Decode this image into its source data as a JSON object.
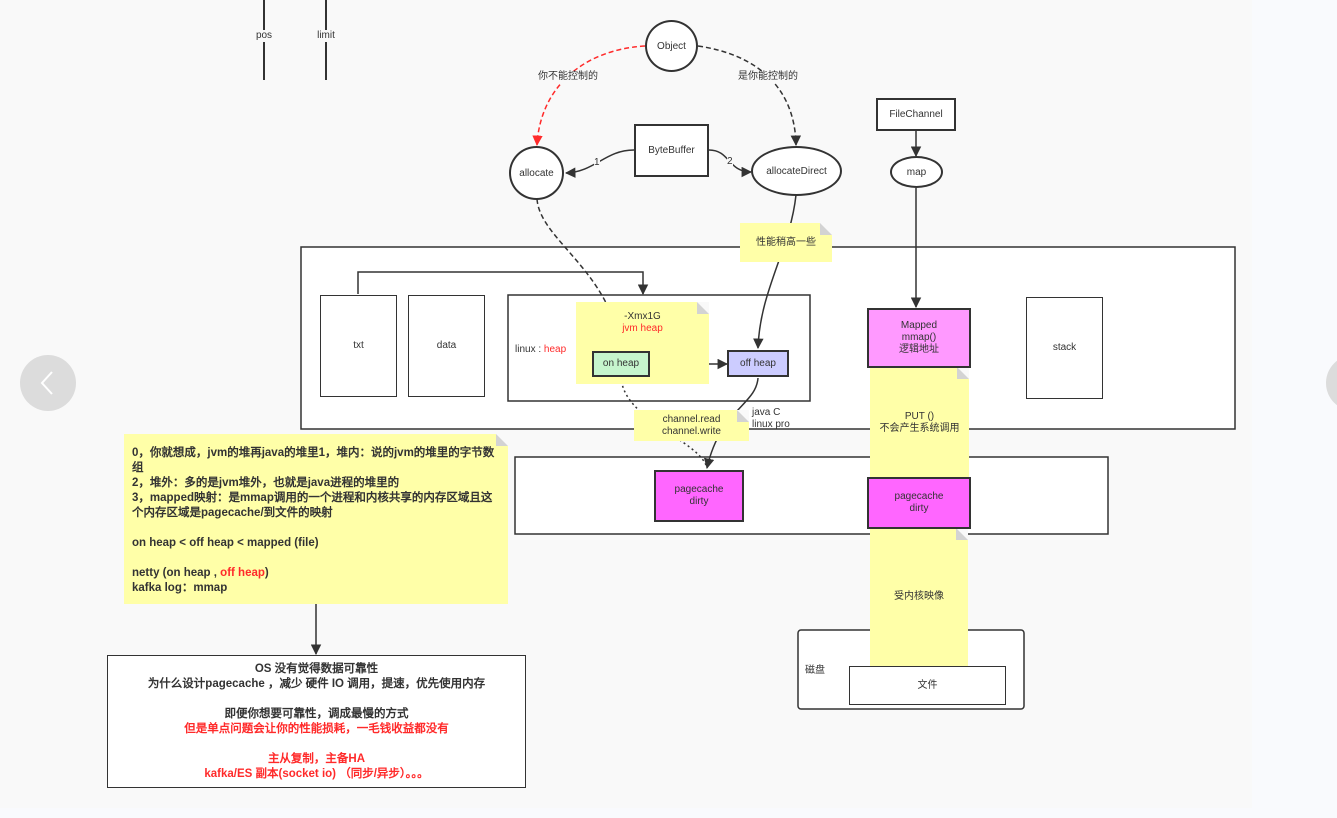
{
  "buffer_markers": {
    "pos": "pos",
    "limit": "limit"
  },
  "nodes": {
    "object": "Object",
    "bytebuffer": "ByteBuffer",
    "allocate": "allocate",
    "allocate_direct": "allocateDirect",
    "filechannel": "FileChannel",
    "map": "map",
    "txt": "txt",
    "data": "data",
    "linux_heap_prefix": "linux : ",
    "linux_heap_red": "heap",
    "on_heap": "on  heap",
    "off_heap": "off heap",
    "mapped": [
      "Mapped",
      "mmap()",
      "逻辑地址"
    ],
    "stack": "stack",
    "pagecache_left": [
      "pagecache",
      "dirty"
    ],
    "pagecache_right": [
      "pagecache",
      "dirty"
    ],
    "disk": "磁盘",
    "file": "文件"
  },
  "edge_labels": {
    "not_controllable": "你不能控制的",
    "controllable": "是你能控制的",
    "edge_1": "1",
    "edge_2": "2",
    "java_c_line1": "java  C",
    "java_c_line2": "linux  pro"
  },
  "notes": {
    "perf_higher": "性能稍高一些",
    "xmx": "-Xmx1G",
    "jvm_heap": "jvm  heap",
    "channel_rw": [
      "channel.read",
      "channel.write"
    ],
    "put_no_syscall": [
      "PUT  ()",
      "不会产生系统调用"
    ],
    "kernel_mapping": "受内核映像",
    "summary": {
      "line0": "0，你就想成，jvm的堆再java的堆里1，堆内：说的jvm的堆里的字节数组",
      "line2": "2，堆外：多的是jvm堆外，也就是java进程的堆里的",
      "line3": "3，mapped映射：是mmap调用的一个进程和内核共享的内存区域且这个内存区域是pagecache/到文件的映射",
      "compare": "on heap  <  off heap  <  mapped  (file)",
      "netty_prefix": "netty  (on heap , ",
      "netty_red": "off heap",
      "netty_suffix": ")",
      "kafka": "kafka  log：mmap"
    }
  },
  "os_box": {
    "line1": "OS 没有觉得数据可靠性",
    "line2": "为什么设计pagecache ，减少  硬件 IO 调用，提速，优先使用内存",
    "line3": "即便你想要可靠性，调成最慢的方式",
    "line4_red": "但是单点问题会让你的性能损耗，一毛钱收益都没有",
    "line5_red": "主从复制，主备HA",
    "line6_red": "kafka/ES 副本(socket io)  （同步/异步）。。。"
  },
  "navigation": {
    "prev": "chevron-left-icon",
    "next": "chevron-right-icon"
  },
  "colors": {
    "on_heap_fill": "#c6f5cd",
    "off_heap_fill": "#ccccff",
    "mapped_fill": "#ff99ff",
    "pagecache_fill": "#ff66ff",
    "note_fill": "#ffffa8",
    "red": "#ff2a2a"
  }
}
